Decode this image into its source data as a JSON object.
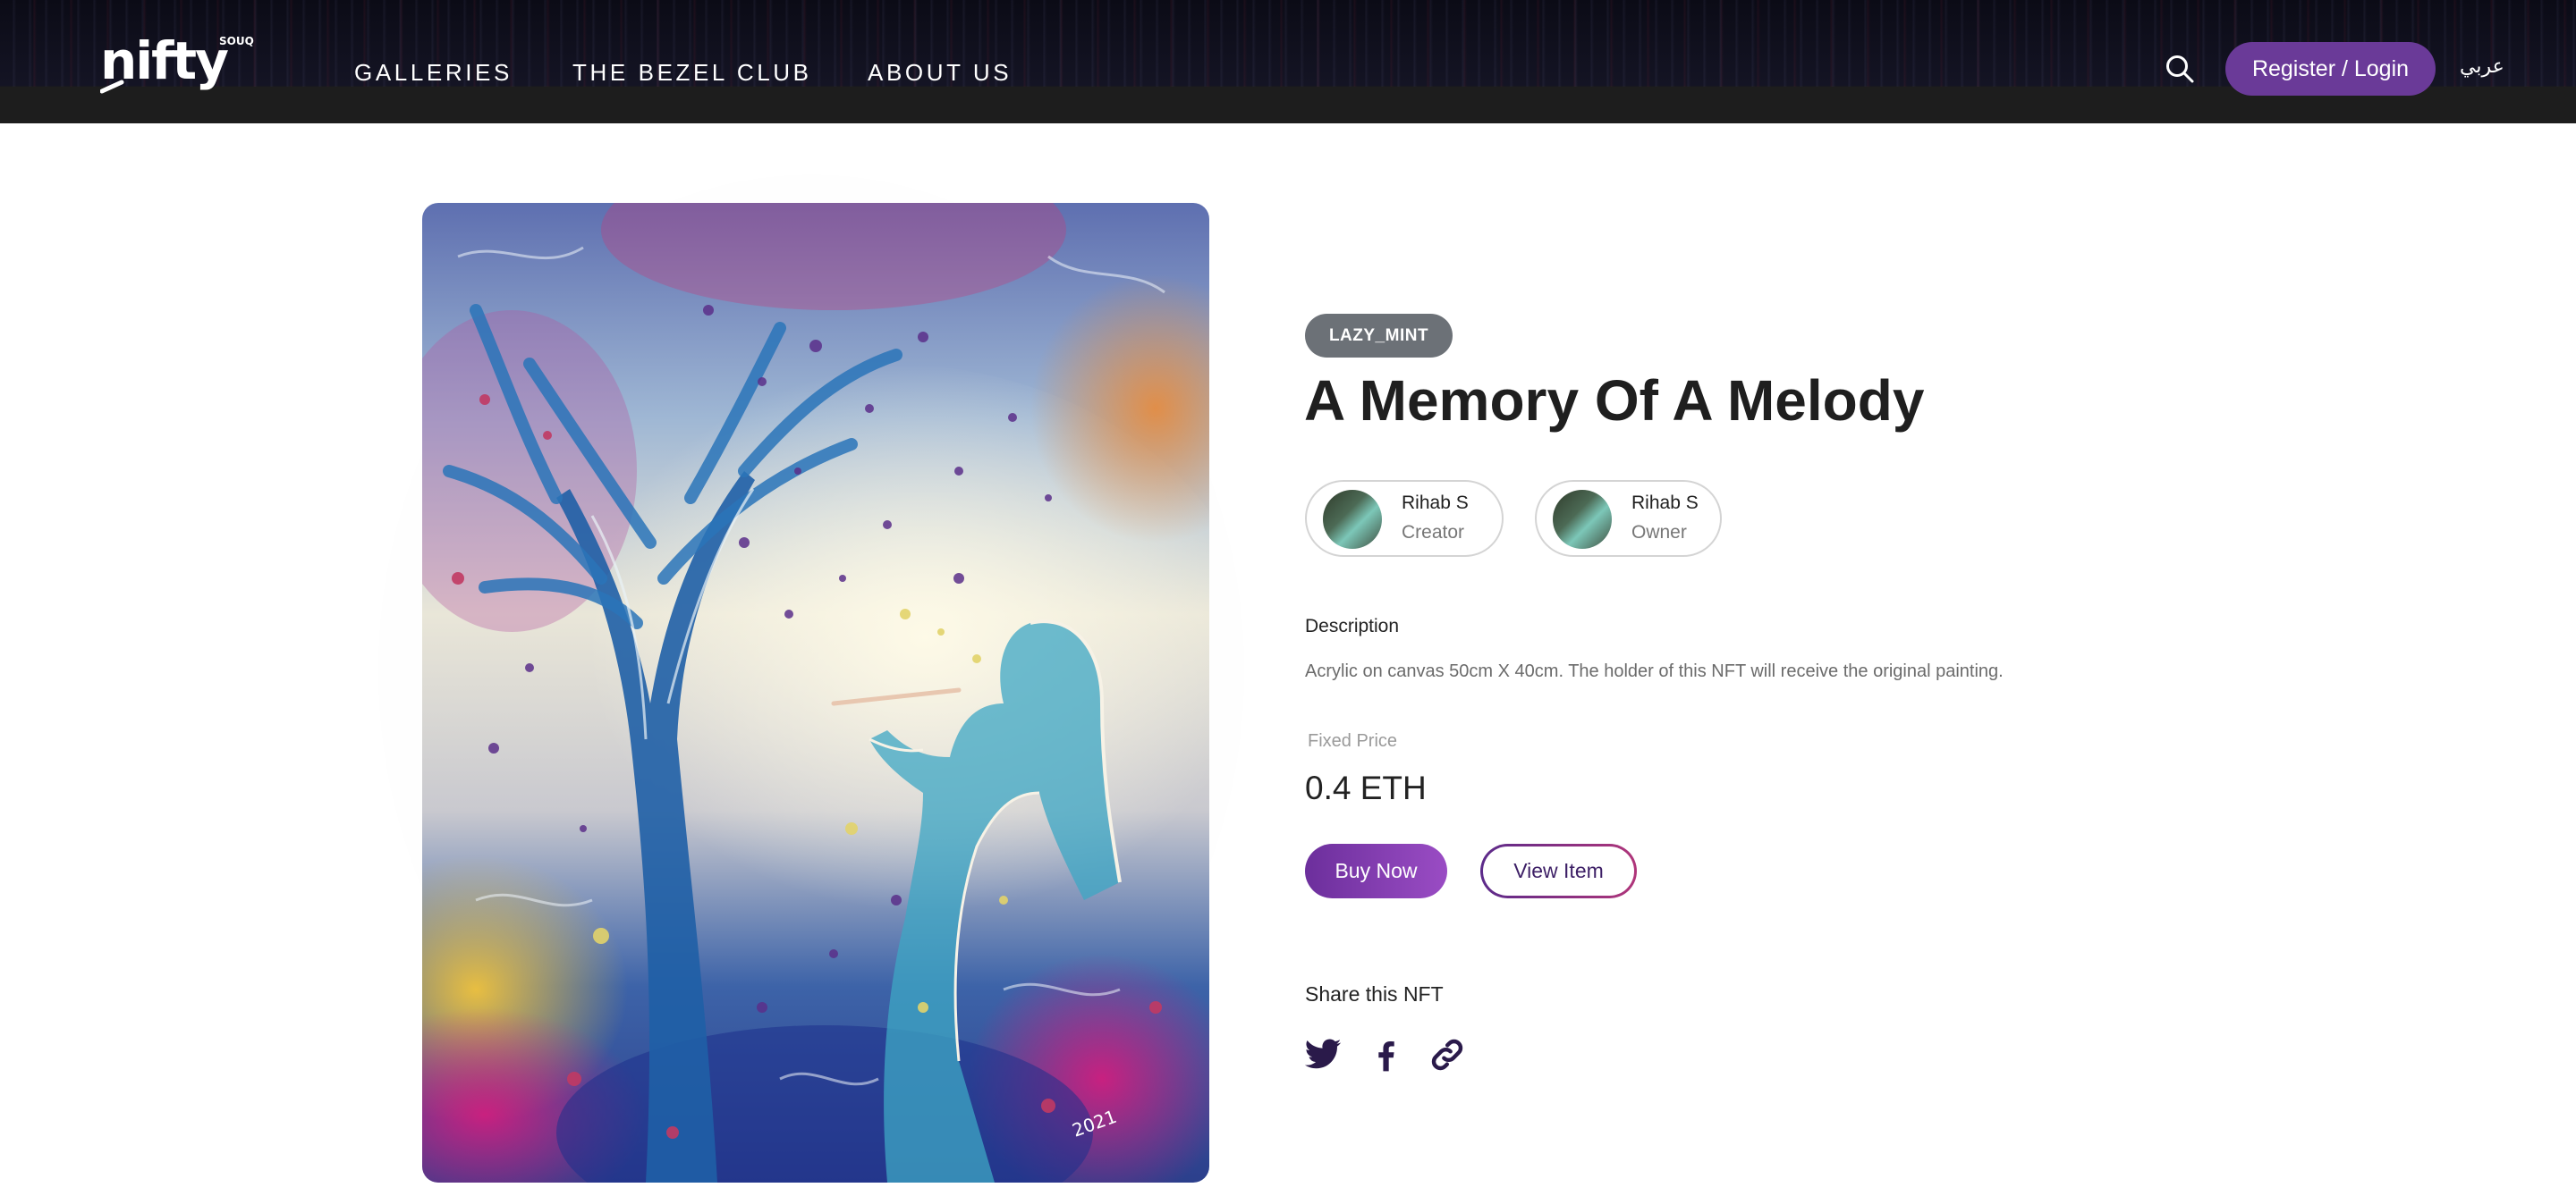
{
  "header": {
    "logo_text": "nifty",
    "logo_tag": "SOUQ",
    "nav": [
      {
        "label": "GALLERIES"
      },
      {
        "label": "THE BEZEL CLUB"
      },
      {
        "label": "ABOUT US"
      }
    ],
    "search_icon": "search-icon",
    "login_label": "Register / Login",
    "language_label": "عربي"
  },
  "artwork": {
    "alt": "A Memory Of A Melody",
    "signature": "2021"
  },
  "details": {
    "badge": "LAZY_MINT",
    "title": "A Memory Of A Melody",
    "people": [
      {
        "name": "Rihab S",
        "role": "Creator"
      },
      {
        "name": "Rihab S",
        "role": "Owner"
      }
    ],
    "description_label": "Description",
    "description": "Acrylic on canvas 50cm X 40cm. The holder of this NFT will receive the original painting.",
    "price_label": "Fixed Price",
    "price": "0.4 ETH",
    "buy_label": "Buy Now",
    "view_label": "View Item",
    "share_label": "Share this NFT",
    "share_icons": [
      "twitter-icon",
      "facebook-icon",
      "link-icon"
    ]
  },
  "colors": {
    "primary": "#6a3a98",
    "badge": "#6c7177",
    "icon": "#2a1a4a"
  }
}
